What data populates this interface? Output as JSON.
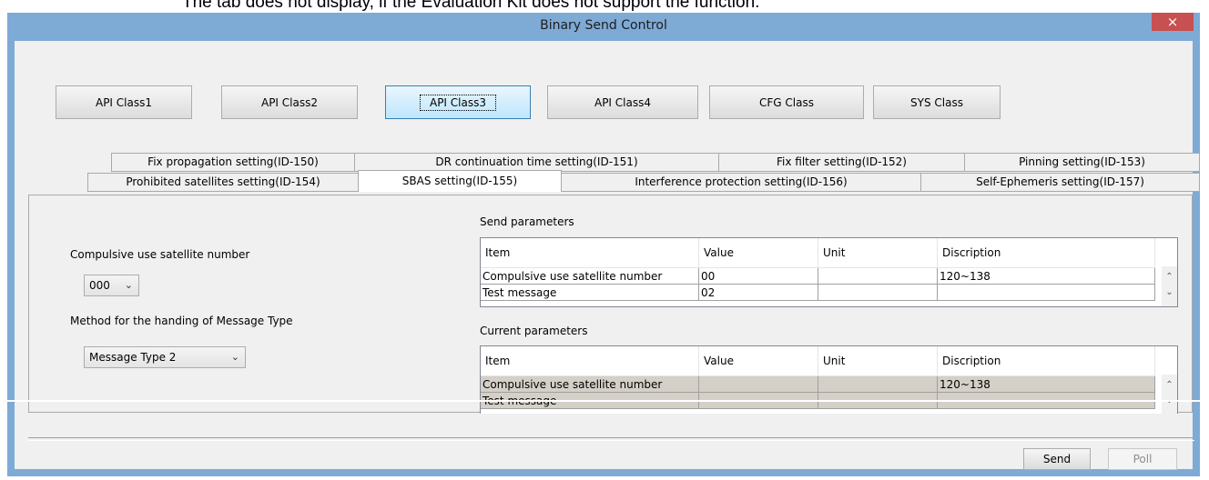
{
  "caption": "The tab does not display, if the Evaluation Kit does not support the function.",
  "window": {
    "title": "Binary Send Control",
    "close_glyph": "×"
  },
  "class_buttons": [
    {
      "label": "API Class1"
    },
    {
      "label": "API Class2"
    },
    {
      "label": "API Class3",
      "active": true
    },
    {
      "label": "API Class4"
    },
    {
      "label": "CFG Class"
    },
    {
      "label": "SYS Class"
    }
  ],
  "tabs_row1": [
    {
      "label": "Fix propagation setting(ID-150)"
    },
    {
      "label": "DR continuation time setting(ID-151)"
    },
    {
      "label": "Fix filter setting(ID-152)"
    },
    {
      "label": "Pinning setting(ID-153)"
    }
  ],
  "tabs_row2": [
    {
      "label": "Prohibited satellites setting(ID-154)"
    },
    {
      "label": "SBAS setting(ID-155)",
      "selected": true
    },
    {
      "label": "Interference protection setting(ID-156)"
    },
    {
      "label": "Self-Ephemeris setting(ID-157)"
    }
  ],
  "form": {
    "sat_label": "Compulsive use satellite number",
    "sat_value": "000",
    "method_label": "Method for the handing of Message Type",
    "method_value": "Message Type 2"
  },
  "send_params": {
    "title": "Send parameters",
    "columns": [
      "Item",
      "Value",
      "Unit",
      "Discription"
    ],
    "rows": [
      [
        "Compulsive use satellite number",
        "00",
        "",
        "120~138"
      ],
      [
        "Test message",
        "02",
        "",
        ""
      ]
    ]
  },
  "current_params": {
    "title": "Current parameters",
    "columns": [
      "Item",
      "Value",
      "Unit",
      "Discription"
    ],
    "rows": [
      [
        "Compulsive use satellite number",
        "",
        "",
        "120~138"
      ],
      [
        "Test message",
        "",
        "",
        ""
      ]
    ]
  },
  "footer": {
    "send_label": "Send",
    "poll_label": "Poll"
  },
  "icons": {
    "combo_arrow": "chevron-down-icon",
    "scroll_up": "scroll-up-icon",
    "scroll_down": "scroll-down-icon"
  }
}
